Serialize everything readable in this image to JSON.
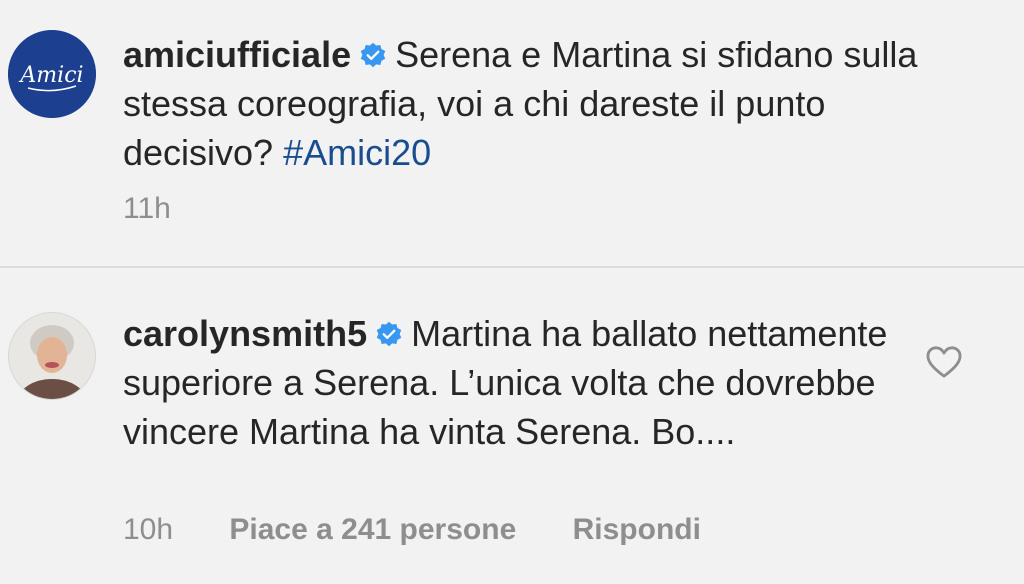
{
  "caption": {
    "username": "amiciufficiale",
    "verified": true,
    "avatar_text": "Amici",
    "text": "Serena e Martina si sfidano sulla stessa coreografia, voi a chi dareste il punto decisivo?",
    "hashtag": "#Amici20",
    "time": "11h"
  },
  "comment": {
    "username": "carolynsmith5",
    "verified": true,
    "text": "Martina ha ballato nettamente superiore a Serena. L’unica volta che dovrebbe vincere Martina ha vinta Serena. Bo....",
    "time": "10h",
    "likes_label": "Piace a 241 persone",
    "reply_label": "Rispondi"
  },
  "colors": {
    "verified_badge": "#3897f0",
    "hashtag": "#1a4d8f",
    "amici_avatar_bg": "#1c3f8f"
  }
}
